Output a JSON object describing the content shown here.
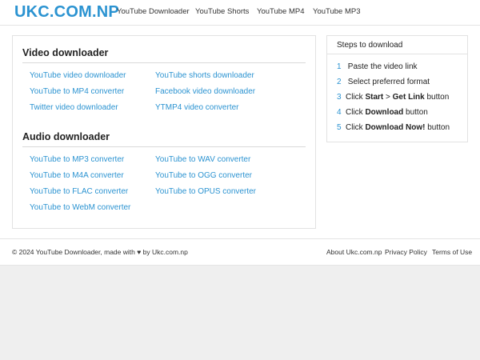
{
  "header": {
    "logo": "UKC.COM.NP",
    "nav": [
      "YouTube Downloader",
      "YouTube Shorts",
      "YouTube MP4",
      "YouTube MP3"
    ]
  },
  "video_section": {
    "title": "Video downloader",
    "links": [
      "YouTube video downloader",
      "YouTube shorts downloader",
      "YouTube to MP4 converter",
      "Facebook video downloader",
      "Twitter video downloader",
      "YTMP4 video converter"
    ]
  },
  "audio_section": {
    "title": "Audio downloader",
    "links": [
      "YouTube to MP3 converter",
      "YouTube to WAV converter",
      "YouTube to M4A converter",
      "YouTube to OGG converter",
      "YouTube to FLAC converter",
      "YouTube to OPUS converter",
      "YouTube to WebM converter"
    ]
  },
  "steps": {
    "title": "Steps to download",
    "items": [
      {
        "num": "1",
        "text": "Paste the video link"
      },
      {
        "num": "2",
        "text": "Select preferred format"
      },
      {
        "num": "3",
        "pre": "Click ",
        "bold1": "Start",
        "mid": " > ",
        "bold2": "Get Link",
        "post": " button"
      },
      {
        "num": "4",
        "pre": "Click ",
        "bold1": "Download",
        "post": " button"
      },
      {
        "num": "5",
        "pre": "Click ",
        "bold1": "Download Now!",
        "post": " button"
      }
    ]
  },
  "footer": {
    "copyright": "© 2024 YouTube Downloader, made with ♥ by Ukc.com.np",
    "links": [
      "About Ukc.com.np",
      "Privacy Policy",
      "Terms of Use"
    ]
  },
  "colors": {
    "accent": "#2b93d1",
    "background": "#efefef"
  }
}
